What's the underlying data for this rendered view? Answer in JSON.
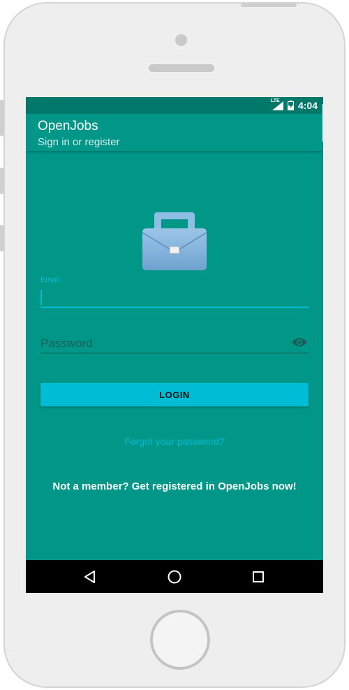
{
  "status_bar": {
    "network_label": "LTE",
    "network_icon": "signal-icon",
    "battery_icon": "battery-charging-icon",
    "time": "4:04"
  },
  "app_bar": {
    "title": "OpenJobs",
    "subtitle": "Sign in or register"
  },
  "logo": {
    "icon": "briefcase-icon"
  },
  "login_form": {
    "email_label": "Email",
    "email_value": "",
    "password_placeholder": "Password",
    "password_value": "",
    "toggle_icon": "eye-icon",
    "login_button": "LOGIN",
    "forgot_link": "Forgot your password?",
    "register_link": "Not a member? Get registered in OpenJobs now!"
  },
  "nav_bar": {
    "back_icon": "back-triangle-icon",
    "home_icon": "home-circle-icon",
    "recents_icon": "recents-square-icon"
  },
  "colors": {
    "primary": "#009688",
    "primary_dark": "#00796b",
    "accent": "#00bcd4",
    "nav_bar": "#000000"
  }
}
